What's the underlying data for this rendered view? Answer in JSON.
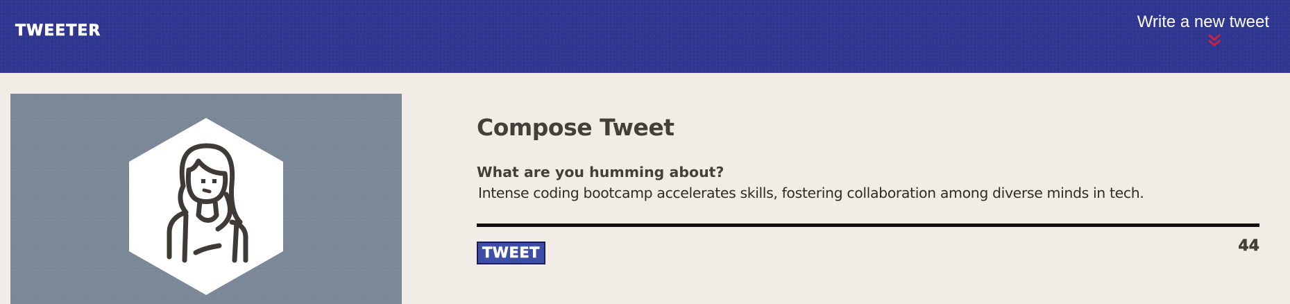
{
  "navbar": {
    "brand": "TWEETER",
    "compose_link": "Write a new tweet",
    "compose_icon": "double-chevron-down-icon"
  },
  "profile": {
    "avatar_icon": "user-avatar-icon"
  },
  "compose": {
    "title": "Compose Tweet",
    "prompt_label": "What are you humming about?",
    "tweet_text": "Intense coding bootcamp accelerates skills, fostering collaboration among diverse minds in tech.",
    "submit_label": "TWEET",
    "char_counter": "44"
  },
  "colors": {
    "navbar_bg": "#2e368f",
    "page_bg": "#f1ede6",
    "profile_bg": "#7b8897",
    "button_bg": "#3d4ea6",
    "chevron": "#d0203c",
    "text_dark": "#433f3a"
  }
}
